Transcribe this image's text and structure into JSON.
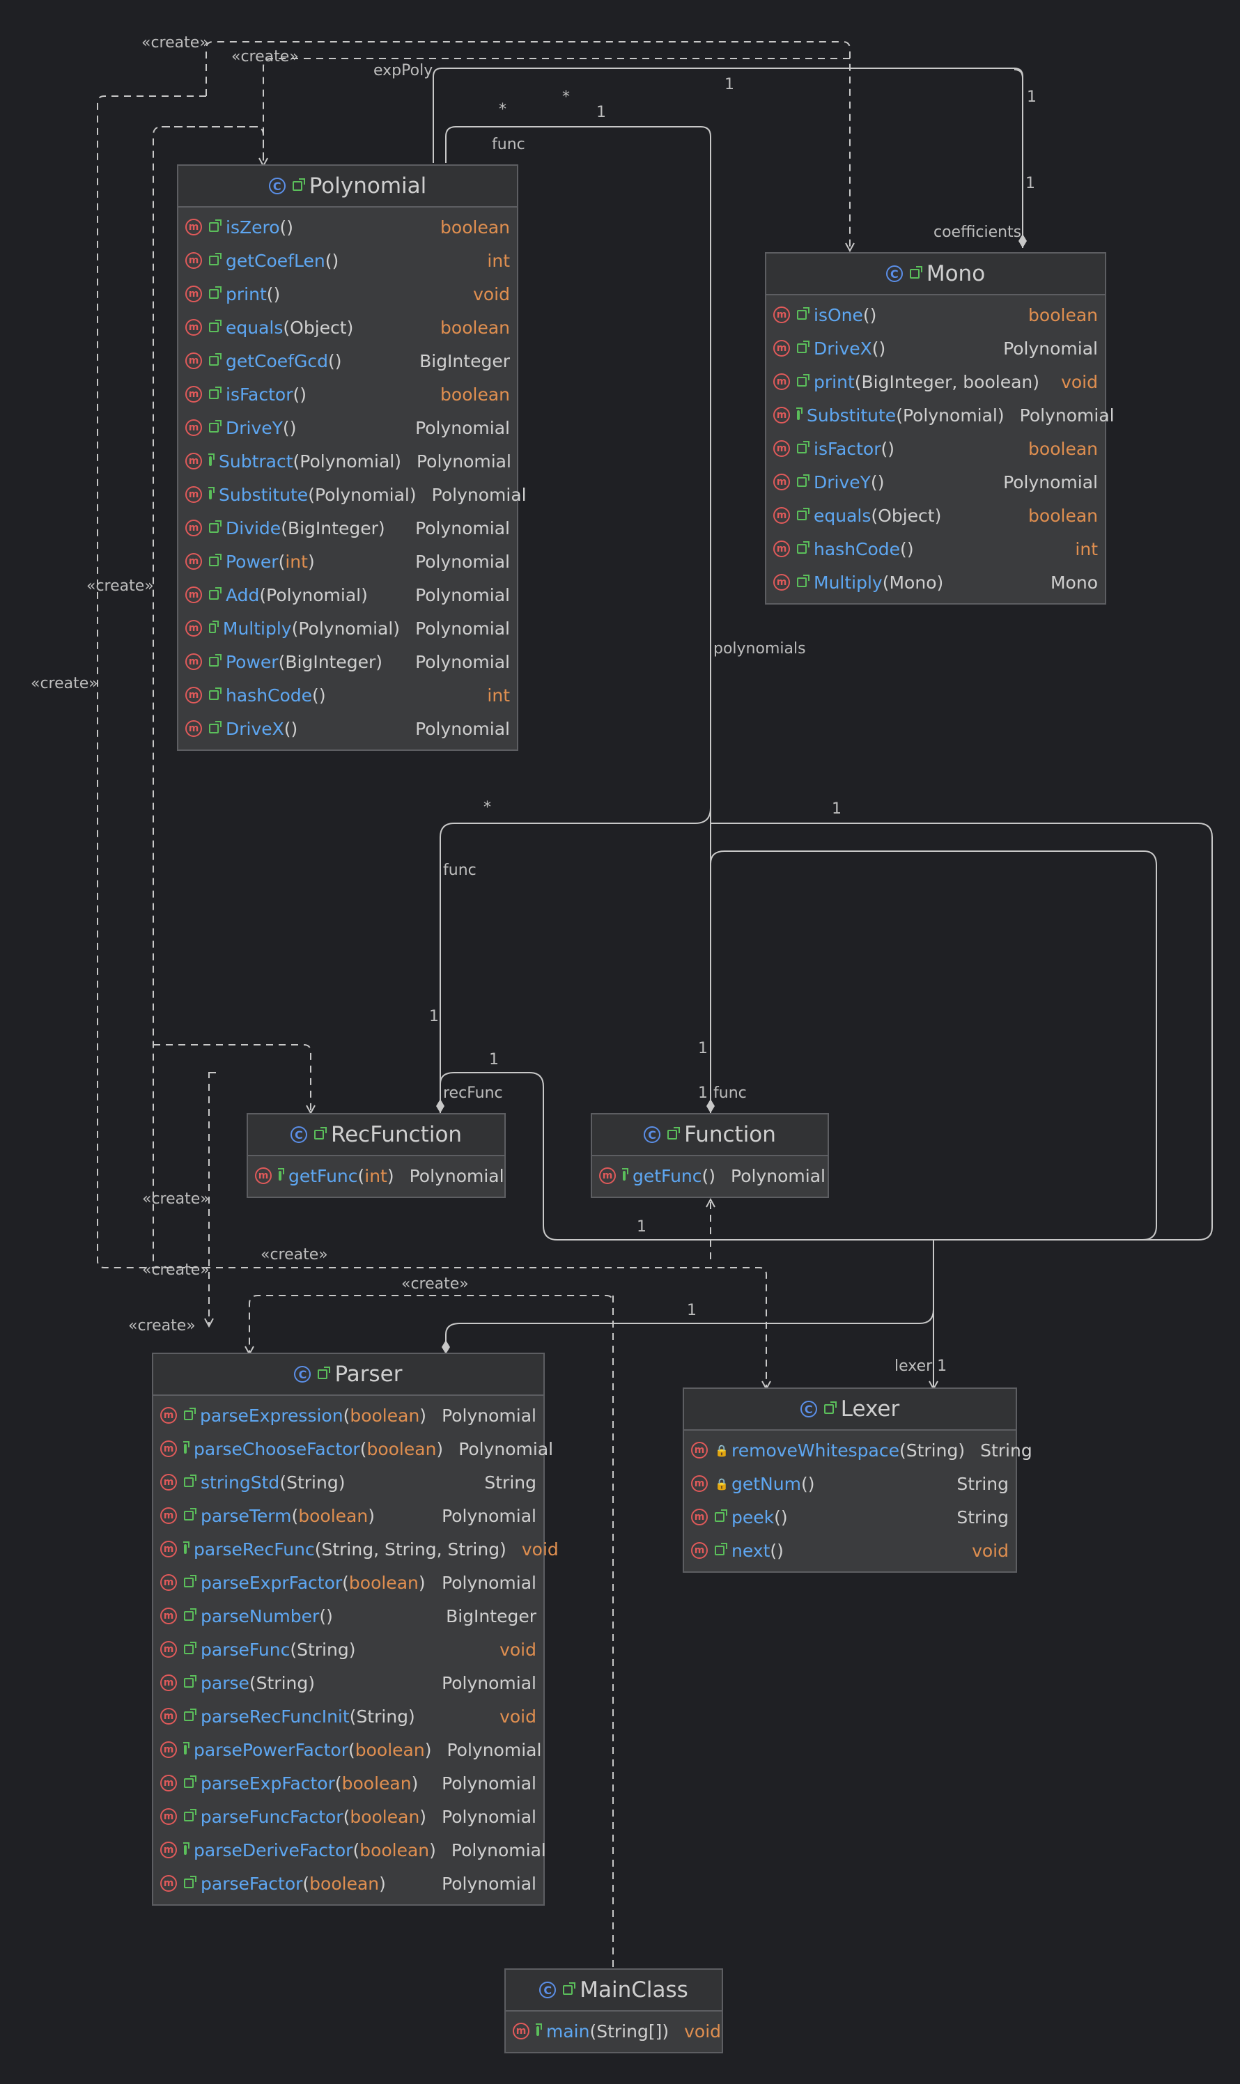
{
  "diagram": {
    "classes": [
      {
        "name": "Polynomial",
        "methods": [
          {
            "name": "isZero",
            "args": "",
            "ret": "boolean"
          },
          {
            "name": "getCoefLen",
            "args": "",
            "ret": "int"
          },
          {
            "name": "print",
            "args": "",
            "ret": "void"
          },
          {
            "name": "equals",
            "args": "Object",
            "ret": "boolean"
          },
          {
            "name": "getCoefGcd",
            "args": "",
            "ret": "BigInteger"
          },
          {
            "name": "isFactor",
            "args": "",
            "ret": "boolean"
          },
          {
            "name": "DriveY",
            "args": "",
            "ret": "Polynomial"
          },
          {
            "name": "Subtract",
            "args": "Polynomial",
            "ret": "Polynomial"
          },
          {
            "name": "Substitute",
            "args": "Polynomial",
            "ret": "Polynomial"
          },
          {
            "name": "Divide",
            "args": "BigInteger",
            "ret": "Polynomial"
          },
          {
            "name": "Power",
            "args": "int",
            "ret": "Polynomial"
          },
          {
            "name": "Add",
            "args": "Polynomial",
            "ret": "Polynomial"
          },
          {
            "name": "Multiply",
            "args": "Polynomial",
            "ret": "Polynomial"
          },
          {
            "name": "Power",
            "args": "BigInteger",
            "ret": "Polynomial"
          },
          {
            "name": "hashCode",
            "args": "",
            "ret": "int"
          },
          {
            "name": "DriveX",
            "args": "",
            "ret": "Polynomial"
          }
        ]
      },
      {
        "name": "Mono",
        "methods": [
          {
            "name": "isOne",
            "args": "",
            "ret": "boolean"
          },
          {
            "name": "DriveX",
            "args": "",
            "ret": "Polynomial"
          },
          {
            "name": "print",
            "args": "BigInteger, boolean",
            "ret": "void"
          },
          {
            "name": "Substitute",
            "args": "Polynomial",
            "ret": "Polynomial"
          },
          {
            "name": "isFactor",
            "args": "",
            "ret": "boolean"
          },
          {
            "name": "DriveY",
            "args": "",
            "ret": "Polynomial"
          },
          {
            "name": "equals",
            "args": "Object",
            "ret": "boolean"
          },
          {
            "name": "hashCode",
            "args": "",
            "ret": "int"
          },
          {
            "name": "Multiply",
            "args": "Mono",
            "ret": "Mono"
          }
        ]
      },
      {
        "name": "RecFunction",
        "methods": [
          {
            "name": "getFunc",
            "args": "int",
            "ret": "Polynomial"
          }
        ]
      },
      {
        "name": "Function",
        "methods": [
          {
            "name": "getFunc",
            "args": "",
            "ret": "Polynomial"
          }
        ]
      },
      {
        "name": "Parser",
        "methods": [
          {
            "name": "parseExpression",
            "args": "boolean",
            "ret": "Polynomial"
          },
          {
            "name": "parseChooseFactor",
            "args": "boolean",
            "ret": "Polynomial"
          },
          {
            "name": "stringStd",
            "args": "String",
            "ret": "String"
          },
          {
            "name": "parseTerm",
            "args": "boolean",
            "ret": "Polynomial"
          },
          {
            "name": "parseRecFunc",
            "args": "String, String, String",
            "ret": "void"
          },
          {
            "name": "parseExprFactor",
            "args": "boolean",
            "ret": "Polynomial"
          },
          {
            "name": "parseNumber",
            "args": "",
            "ret": "BigInteger"
          },
          {
            "name": "parseFunc",
            "args": "String",
            "ret": "void"
          },
          {
            "name": "parse",
            "args": "String",
            "ret": "Polynomial"
          },
          {
            "name": "parseRecFuncInit",
            "args": "String",
            "ret": "void"
          },
          {
            "name": "parsePowerFactor",
            "args": "boolean",
            "ret": "Polynomial"
          },
          {
            "name": "parseExpFactor",
            "args": "boolean",
            "ret": "Polynomial"
          },
          {
            "name": "parseFuncFactor",
            "args": "boolean",
            "ret": "Polynomial"
          },
          {
            "name": "parseDeriveFactor",
            "args": "boolean",
            "ret": "Polynomial"
          },
          {
            "name": "parseFactor",
            "args": "boolean",
            "ret": "Polynomial"
          }
        ]
      },
      {
        "name": "Lexer",
        "methods": [
          {
            "name": "removeWhitespace",
            "args": "String",
            "ret": "String",
            "visibility": "private"
          },
          {
            "name": "getNum",
            "args": "",
            "ret": "String",
            "visibility": "private"
          },
          {
            "name": "peek",
            "args": "",
            "ret": "String"
          },
          {
            "name": "next",
            "args": "",
            "ret": "void"
          }
        ]
      },
      {
        "name": "MainClass",
        "methods": [
          {
            "name": "main",
            "args": "String[]",
            "ret": "void"
          }
        ]
      }
    ],
    "labels": [
      "«create»",
      "«create»",
      "expPoly",
      "*",
      "*",
      "1",
      "1",
      "func",
      "1",
      "1",
      "coefficients",
      "«create»",
      "«create»",
      "polynomials",
      "*",
      "1",
      "func",
      "1",
      "1",
      "1",
      "recFunc",
      "1",
      "func",
      "1",
      "«create»",
      "«create»",
      "«create»",
      "«create»",
      "«create»",
      "1",
      "lexer 1"
    ]
  },
  "colors": {
    "background": "#1f2024",
    "class_fill": "#3b3c3e",
    "class_header": "#323335",
    "border": "#5d5e62",
    "method_name": "#5ea7f2",
    "keyword_type": "#e08f50",
    "text": "#cfcfcf",
    "edge": "#c8c8c8",
    "class_icon": "#5b8fe8",
    "method_icon": "#e05a5a",
    "public_icon": "#5bbf5b"
  }
}
